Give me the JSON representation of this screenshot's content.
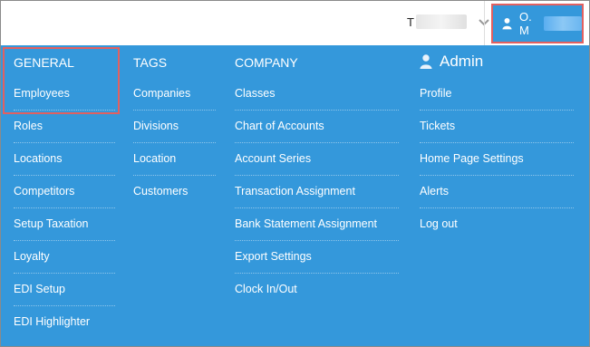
{
  "topbar": {
    "tenant_initial": "T",
    "user_initial": "O. M"
  },
  "menu": {
    "general": {
      "header": "GENERAL",
      "items": [
        "Employees",
        "Roles",
        "Locations",
        "Competitors",
        "Setup Taxation",
        "Loyalty",
        "EDI Setup",
        "EDI Highlighter"
      ]
    },
    "tags": {
      "header": "TAGS",
      "items": [
        "Companies",
        "Divisions",
        "Location",
        "Customers"
      ]
    },
    "company": {
      "header": "COMPANY",
      "items": [
        "Classes",
        "Chart of Accounts",
        "Account Series",
        "Transaction Assignment",
        "Bank Statement Assignment",
        "Export Settings",
        "Clock In/Out"
      ]
    },
    "admin": {
      "header": "Admin",
      "items": [
        "Profile",
        "Tickets",
        "Home Page Settings",
        "Alerts",
        "Log out"
      ]
    }
  },
  "colors": {
    "menu_bg": "#3498db",
    "highlight": "#e26060",
    "text": "#ffffff"
  },
  "icons": {
    "user": "user-icon",
    "chevron": "chevron-down-icon"
  }
}
